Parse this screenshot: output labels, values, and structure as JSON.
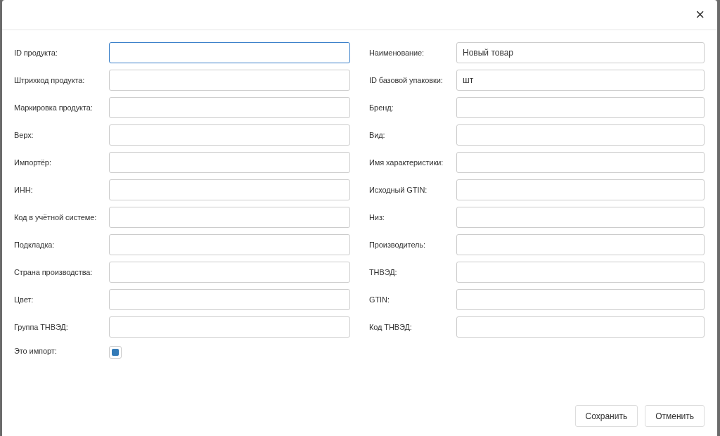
{
  "dialog": {
    "close": "×"
  },
  "fields_left": [
    {
      "label": "ID продукта:",
      "focused": true
    },
    {
      "label": "Штрихкод продукта:",
      "focused": false
    },
    {
      "label": "Маркировка продукта:",
      "focused": false
    },
    {
      "label": "Верх:",
      "focused": false
    },
    {
      "label": "Импортёр:",
      "focused": false
    },
    {
      "label": "ИНН:",
      "focused": false
    },
    {
      "label": "Код в учётной системе:",
      "focused": false
    },
    {
      "label": "Подкладка:",
      "focused": false
    },
    {
      "label": "Страна производства:",
      "focused": false
    },
    {
      "label": "Цвет:",
      "focused": false
    },
    {
      "label": "Группа ТНВЭД:",
      "focused": false
    }
  ],
  "fields_right": [
    {
      "label": "Наименование:",
      "value": "Новый товар",
      "focused": false
    },
    {
      "label": "ID базовой упаковки:",
      "value": "шт",
      "focused": false
    },
    {
      "label": "Бренд:",
      "focused": false
    },
    {
      "label": "Вид:",
      "focused": false
    },
    {
      "label": "Имя характеристики:",
      "focused": false
    },
    {
      "label": "Исходный GTIN:",
      "focused": false
    },
    {
      "label": "Низ:",
      "focused": false
    },
    {
      "label": "Производитель:",
      "focused": false
    },
    {
      "label": "ТНВЭД:",
      "focused": false
    },
    {
      "label": "GTIN:",
      "focused": false
    },
    {
      "label": "Код ТНВЭД:",
      "focused": false
    }
  ],
  "import_checkbox": {
    "label": "Это импорт:",
    "checked": true
  },
  "buttons": [
    "Сохранить",
    "Отменить"
  ]
}
